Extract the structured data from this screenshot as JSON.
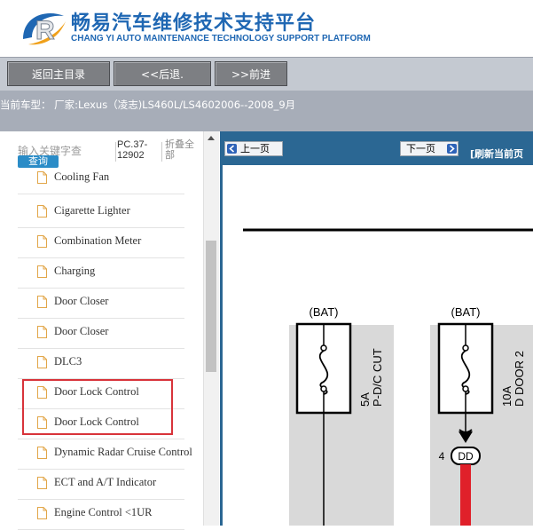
{
  "header": {
    "title": "畅易汽车维修技术支持平台",
    "subtitle": "CHANG YI AUTO MAINTENANCE TECHNOLOGY SUPPORT PLATFORM"
  },
  "toolbar": {
    "home_label": "返回主目录",
    "back_label": "<<后退.",
    "forward_label": ">>前进"
  },
  "model": {
    "text": "当前车型： 厂家:Lexus（凌志)LS460L/LS4602006--2008_9月"
  },
  "search": {
    "placeholder": "输入关键字查",
    "query_label": "查询",
    "pc_code": "PC.37-12902",
    "fold_label": "折叠全部"
  },
  "tree": {
    "items": [
      {
        "label": "Cooling Fan"
      },
      {
        "label": "Cigarette Lighter"
      },
      {
        "label": "Combination Meter"
      },
      {
        "label": "Charging"
      },
      {
        "label": "Door Closer"
      },
      {
        "label": "Door Closer"
      },
      {
        "label": "DLC3"
      },
      {
        "label": "Door Lock Control"
      },
      {
        "label": "Door Lock Control"
      },
      {
        "label": "Dynamic Radar Cruise Control"
      },
      {
        "label": "ECT and A/T Indicator"
      },
      {
        "label": "Engine Control <1UR"
      }
    ]
  },
  "pager": {
    "prev_label": "上一页",
    "next_label": "下一页",
    "refresh_label": "[刷新当前页"
  },
  "diagram": {
    "bat1": "(BAT)",
    "bat2": "(BAT)",
    "fuse1_rating": "5A",
    "fuse1_name": "P-D/C CUT",
    "fuse2_rating": "10A",
    "fuse2_name": "D DOOR 2",
    "connector_pin": "4",
    "connector_name": "DD"
  },
  "colors": {
    "brand_blue": "#1f67b3",
    "pager_bar": "#2b6793",
    "highlight": "#d8333a",
    "wire_red": "#e0202a"
  }
}
